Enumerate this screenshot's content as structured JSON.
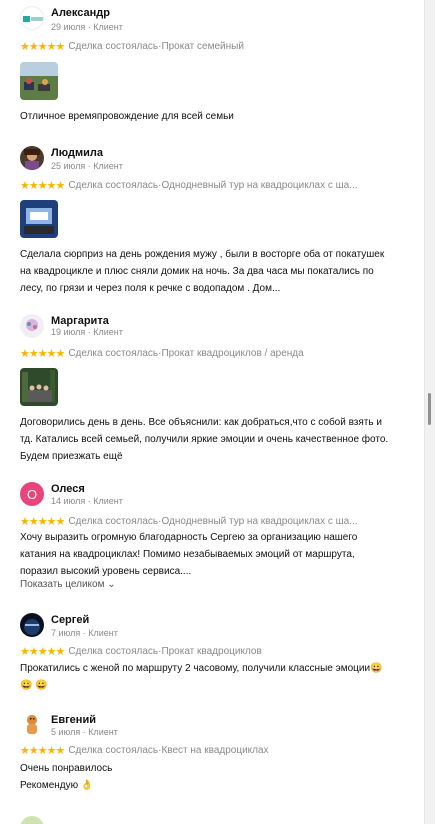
{
  "reviews": [
    {
      "name": "Александр",
      "date": "29 июля",
      "role": "Клиент",
      "stars": "★★★★★",
      "deal": "Сделка состоялась",
      "service": "Прокат семейный",
      "text": "Отличное времяпровождение для всей семьи"
    },
    {
      "name": "Людмила",
      "date": "25 июля",
      "role": "Клиент",
      "stars": "★★★★★",
      "deal": "Сделка состоялась",
      "service": "Однодневный тур на квадроциклах с ша...",
      "text": "Сделала сюрприз на день рождения мужу , были в восторге оба от покатушек на квадроцикле и плюс сняли домик на ночь. За два часа мы покатались по лесу, по грязи и через поля к речке с водопадом . Дом..."
    },
    {
      "name": "Маргарита",
      "date": "19 июля",
      "role": "Клиент",
      "stars": "★★★★★",
      "deal": "Сделка состоялась",
      "service": "Прокат квадроциклов / аренда",
      "text": "Договорились день в день. Все объяснили: как добраться,что с собой взять и тд. Катались всей семьей, получили яркие эмоции и очень качественное фото. Будем приезжать ещё"
    },
    {
      "name": "Олеся",
      "date": "14 июля",
      "role": "Клиент",
      "avatar_letter": "О",
      "stars": "★★★★★",
      "deal": "Сделка состоялась",
      "service": "Однодневный тур на квадроциклах с ша...",
      "text": "Хочу выразить огромную благодарность Сергею за организацию нашего катания на квадроциклах! Помимо незабываемых эмоций от маршрута, поразил высокий уровень сервиса....",
      "expand_label": "Показать целиком ⌄"
    },
    {
      "name": "Сергей",
      "date": "7 июля",
      "role": "Клиент",
      "stars": "★★★★★",
      "deal": "Сделка состоялась",
      "service": "Прокат квадроциклов",
      "text": "Прокатились с женой по маршруту 2 часовому, получили классные эмоции😀 😀 😀"
    },
    {
      "name": "Евгений",
      "date": "5 июля",
      "role": "Клиент",
      "stars": "★★★★★",
      "deal": "Сделка состоялась",
      "service": "Квест на квадроциклах",
      "text_line1": "Очень понравилось",
      "text_line2": "Рекомендую 👌"
    }
  ],
  "separator": " · ",
  "colors": {
    "star": "#f7b500",
    "muted": "#8a8a8a",
    "olesya_avatar": "#e8457a"
  }
}
